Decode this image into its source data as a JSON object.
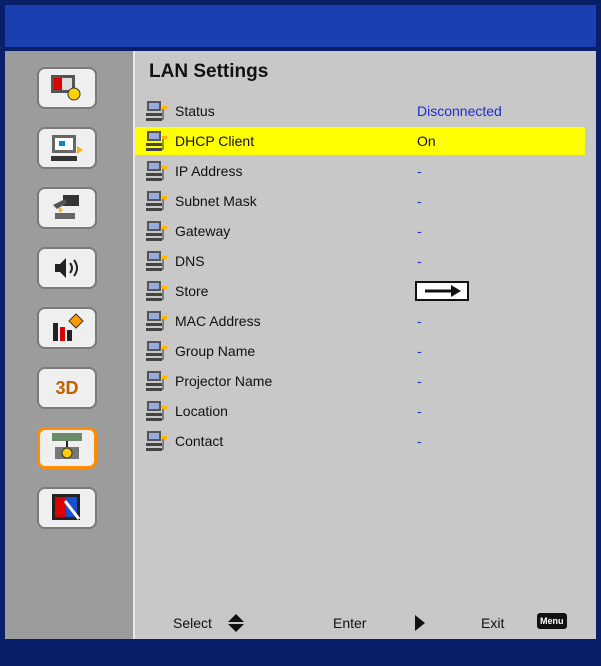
{
  "osd": {
    "heading": "LAN Settings",
    "rows": [
      {
        "label": "Status",
        "value": "Disconnected"
      },
      {
        "label": "DHCP Client",
        "value": "On"
      },
      {
        "label": "IP Address",
        "value": "-"
      },
      {
        "label": "Subnet Mask",
        "value": "-"
      },
      {
        "label": "Gateway",
        "value": "-"
      },
      {
        "label": "DNS",
        "value": "-"
      },
      {
        "label": "Store",
        "value": ""
      },
      {
        "label": "MAC Address",
        "value": "-"
      },
      {
        "label": "Group Name",
        "value": "-"
      },
      {
        "label": "Projector Name",
        "value": "-"
      },
      {
        "label": "Location",
        "value": "-"
      },
      {
        "label": "Contact",
        "value": "-"
      }
    ],
    "selected_row": "DHCP Client",
    "sidebar_items": [
      "image-settings-icon",
      "display-settings-icon",
      "setup-icon",
      "volume-icon",
      "options-icon",
      "3d-icon",
      "lan-icon",
      "interactive-icon"
    ],
    "sidebar_3d_label": "3D",
    "footer": {
      "select": "Select",
      "enter": "Enter",
      "exit": "Exit",
      "menu_badge": "Menu"
    },
    "colors": {
      "highlight": "#ffff00",
      "active_border": "#ff8c00",
      "value_text": "#1a2fd0"
    }
  }
}
